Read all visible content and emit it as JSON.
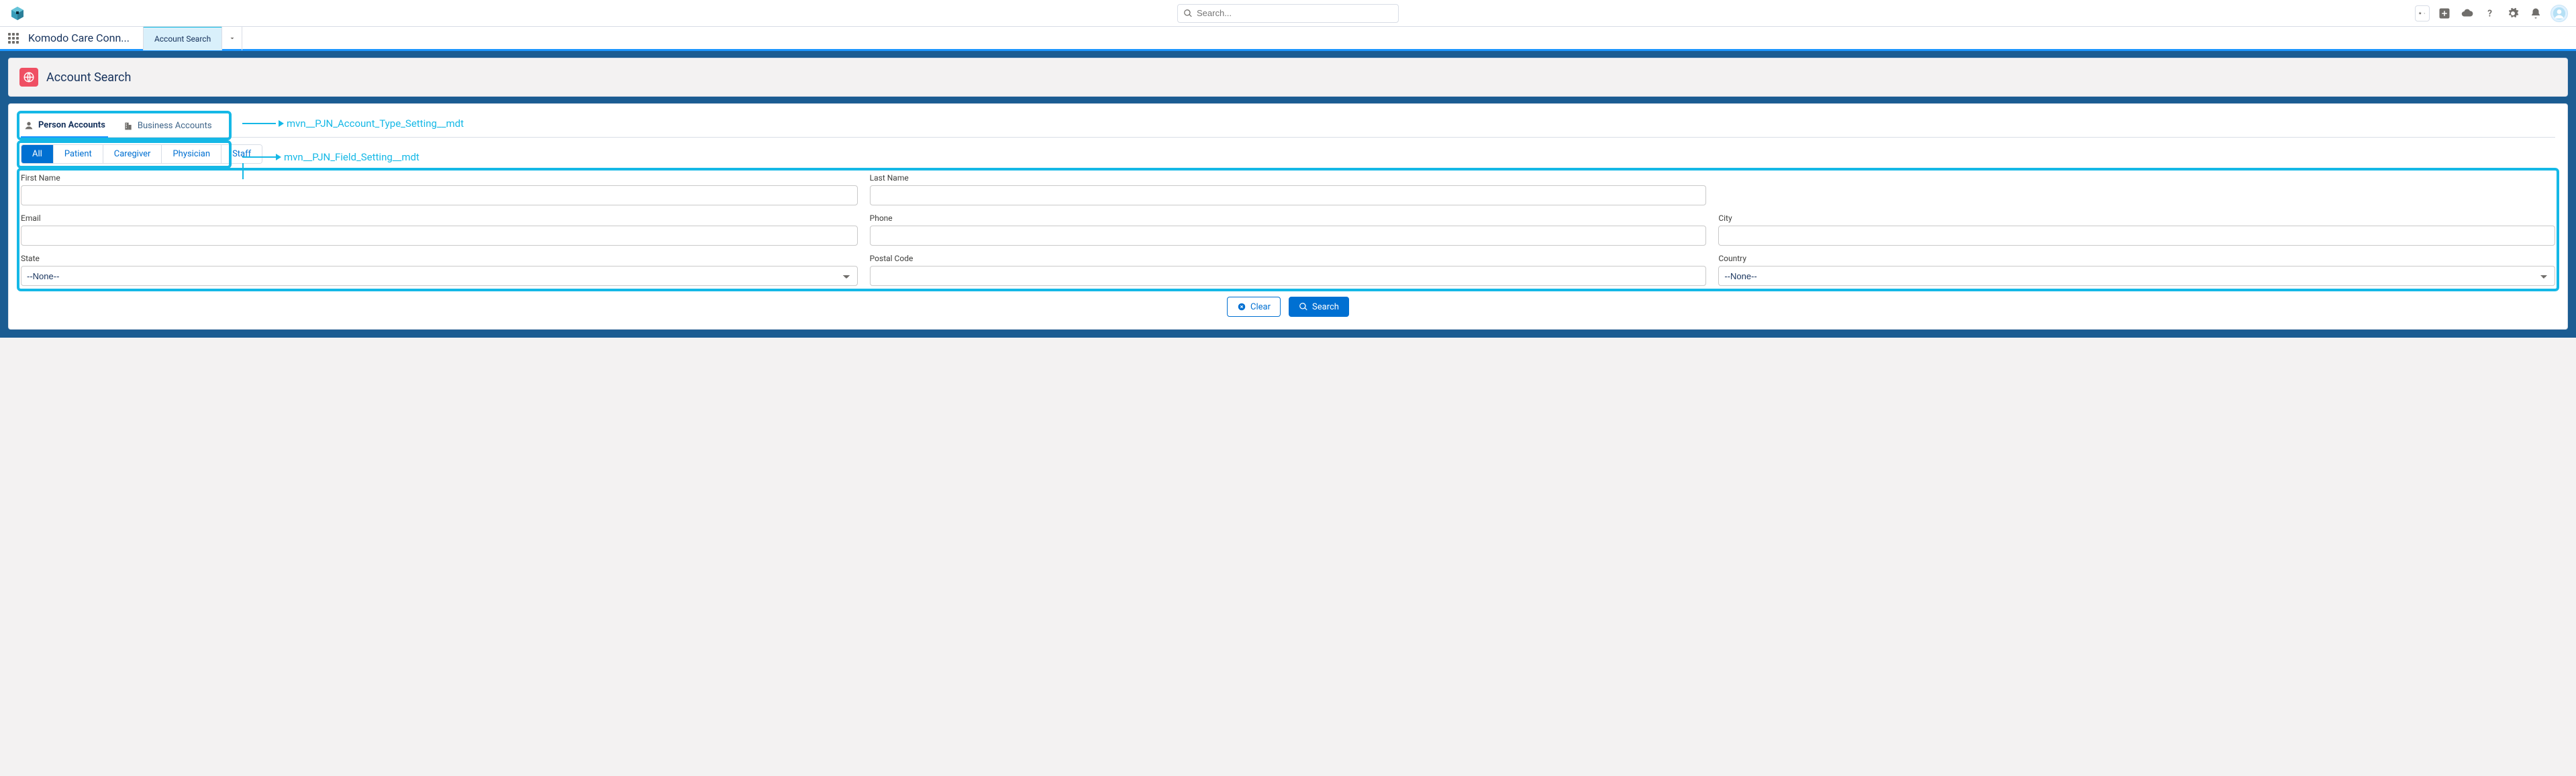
{
  "header": {
    "search_placeholder": "Search..."
  },
  "app": {
    "name": "Komodo Care Conn...",
    "tab_label": "Account Search"
  },
  "page": {
    "title": "Account Search"
  },
  "account_tabs": {
    "person": "Person Accounts",
    "business": "Business Accounts"
  },
  "annotations": {
    "tabs_callout": "mvn__PJN_Account_Type_Setting__mdt",
    "fields_callout": "mvn__PJN_Field_Setting__mdt"
  },
  "pills": {
    "all": "All",
    "patient": "Patient",
    "caregiver": "Caregiver",
    "physician": "Physician",
    "staff": "Staff"
  },
  "form": {
    "first_name": {
      "label": "First Name",
      "value": ""
    },
    "last_name": {
      "label": "Last Name",
      "value": ""
    },
    "email": {
      "label": "Email",
      "value": ""
    },
    "phone": {
      "label": "Phone",
      "value": ""
    },
    "city": {
      "label": "City",
      "value": ""
    },
    "state": {
      "label": "State",
      "selected": "--None--"
    },
    "postal": {
      "label": "Postal Code",
      "value": ""
    },
    "country": {
      "label": "Country",
      "selected": "--None--"
    }
  },
  "actions": {
    "clear": "Clear",
    "search": "Search"
  }
}
